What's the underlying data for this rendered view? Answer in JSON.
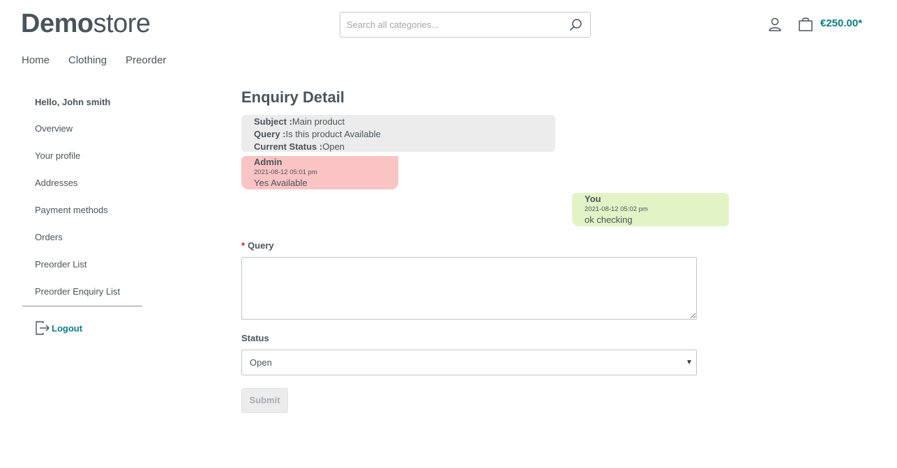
{
  "header": {
    "logo_bold": "Demo",
    "logo_light": "store",
    "search_placeholder": "Search all categories...",
    "search_icon": "search-icon",
    "account_icon": "user-icon",
    "cart_icon": "bag-icon",
    "cart_total": "€250.00*",
    "accent_color": "#0b7d85"
  },
  "nav": {
    "items": [
      "Home",
      "Clothing",
      "Preorder"
    ]
  },
  "sidebar": {
    "greeting": "Hello, John smith",
    "items": [
      "Overview",
      "Your profile",
      "Addresses",
      "Payment methods",
      "Orders",
      "Preorder List",
      "Preorder Enquiry List"
    ],
    "logout_label": "Logout",
    "logout_icon": "logout-icon"
  },
  "main": {
    "title": "Enquiry Detail",
    "subject_label": "Subject :",
    "subject_value": "Main product",
    "query_label": "Query :",
    "query_value": "Is this product Available",
    "status_label": "Current Status :",
    "status_value": "Open",
    "messages": [
      {
        "author": "Admin",
        "time": "2021-08-12 05:01 pm",
        "text": "Yes Available",
        "color": "#fbc4c4"
      },
      {
        "author": "You",
        "time": "2021-08-12 05:02 pm",
        "text": "ok checking",
        "color": "#e2f4c6"
      }
    ],
    "form": {
      "required_mark": "*",
      "query_field_label": "Query",
      "query_field_value": "",
      "status_field_label": "Status",
      "status_selected": "Open",
      "submit_label": "Submit"
    }
  }
}
